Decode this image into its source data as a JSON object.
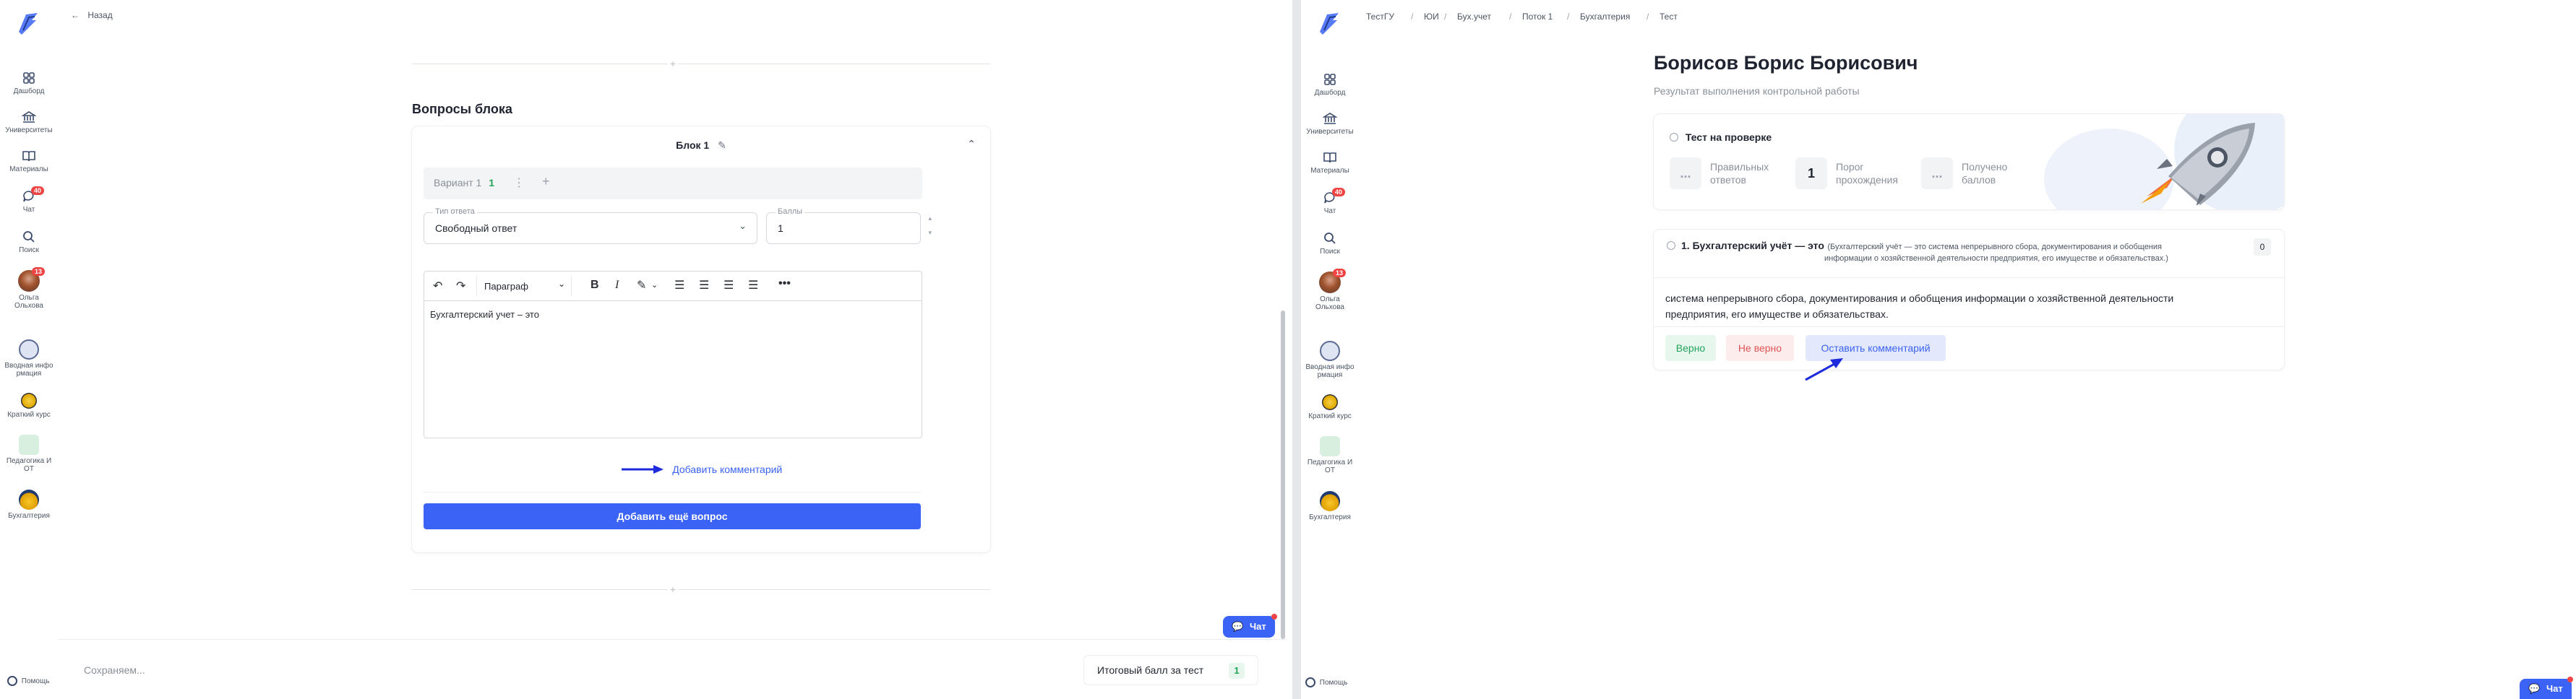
{
  "sidebar": {
    "items": [
      {
        "label": "Дашборд",
        "icon": "dashboard-icon"
      },
      {
        "label": "Университеты",
        "icon": "university-icon"
      },
      {
        "label": "Материалы",
        "icon": "book-icon"
      },
      {
        "label": "Чат",
        "icon": "chat-icon",
        "badge": "40"
      },
      {
        "label": "Поиск",
        "icon": "search-icon"
      },
      {
        "label": "Ольга Ольхова",
        "icon": "avatar",
        "badge": "13"
      }
    ],
    "courses": [
      {
        "label": "Вводная информация",
        "line1": "Вводная инфо",
        "line2": "рмация"
      },
      {
        "label": "Краткий курс",
        "line1": "Краткий курс",
        "line2": ""
      },
      {
        "label": "Педагогика и ОТ",
        "line1": "Педагогика И",
        "line2": "ОТ"
      },
      {
        "label": "Бухгалтерия",
        "line1": "Бухгалтерия",
        "line2": ""
      }
    ],
    "help": "Помощь"
  },
  "left": {
    "back": "Назад",
    "section_title": "Вопросы блока",
    "block_title": "Блок 1",
    "variant_label": "Вариант 1",
    "variant_count": "1",
    "answer_type_label": "Тип ответа",
    "answer_type_value": "Свободный ответ",
    "score_label": "Баллы",
    "score_value": "1",
    "paragraph_select": "Параграф",
    "editor_text": "Бухгалтерский учет – это",
    "add_comment": "Добавить комментарий",
    "add_question": "Добавить ещё вопрос",
    "saving": "Сохраняем...",
    "total_label": "Итоговый балл за тест",
    "total_value": "1",
    "chat": "Чат"
  },
  "right": {
    "breadcrumbs": [
      "ТестГУ",
      "ЮИ",
      "Бух.учет",
      "Поток 1",
      "Бухгалтерия",
      "Тест"
    ],
    "student_name": "Борисов Борис Борисович",
    "subtitle": "Результат выполнения контрольной работы",
    "status": "Тест на проверке",
    "stats": [
      {
        "value": "...",
        "line1": "Правильных",
        "line2": "ответов"
      },
      {
        "value": "1",
        "line1": "Порог",
        "line2": "прохождения"
      },
      {
        "value": "...",
        "line1": "Получено",
        "line2": "баллов"
      }
    ],
    "question_title": "1. Бухгалтерский учёт — это",
    "question_hint_1": "(Бухгалтерский учёт — это система непрерывного сбора, документирования и обобщения",
    "question_hint_2": "информации о хозяйственной деятельности предприятия, его имуществе и обязательствах.)",
    "question_score": "0",
    "answer_line_1": "система непрерывного сбора, документирования и обобщения информации о хозяйственной деятельности",
    "answer_line_2": "предприятия, его имуществе и обязательствах.",
    "correct": "Верно",
    "incorrect": "Не верно",
    "leave_comment": "Оставить комментарий",
    "help": "Помощь",
    "chat": "Чат"
  },
  "colors": {
    "accent": "#3b63f5",
    "badge": "#ef4444",
    "correct_bg": "#e7f7ee",
    "correct_fg": "#22a35a",
    "wrong_bg": "#fdecec",
    "wrong_fg": "#e25555",
    "comment_bg": "#e3e8fd",
    "arrow": "#1d2bdc"
  }
}
